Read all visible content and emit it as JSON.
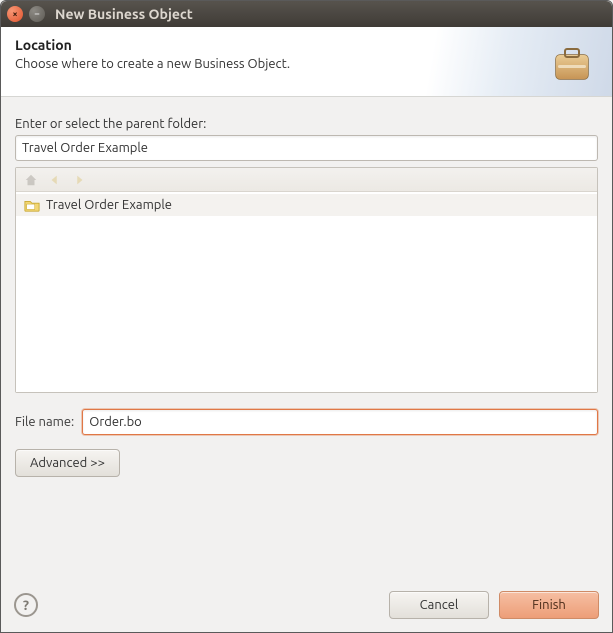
{
  "window": {
    "title": "New Business Object"
  },
  "banner": {
    "heading": "Location",
    "subtext": "Choose where to create a new Business Object."
  },
  "parent": {
    "label": "Enter or select the parent folder:",
    "value": "Travel Order Example"
  },
  "tree": {
    "items": [
      {
        "label": "Travel Order Example"
      }
    ]
  },
  "filename": {
    "label": "File name:",
    "value": "Order.bo"
  },
  "buttons": {
    "advanced": "Advanced >>",
    "cancel": "Cancel",
    "finish": "Finish"
  },
  "icons": {
    "briefcase": "briefcase-icon",
    "home": "home-icon",
    "back": "back-icon",
    "forward": "forward-icon",
    "folder": "folder-icon",
    "help": "?"
  },
  "colors": {
    "accent": "#e07746",
    "titlebar_bg": "#47433d",
    "window_bg": "#f2f1f0"
  }
}
